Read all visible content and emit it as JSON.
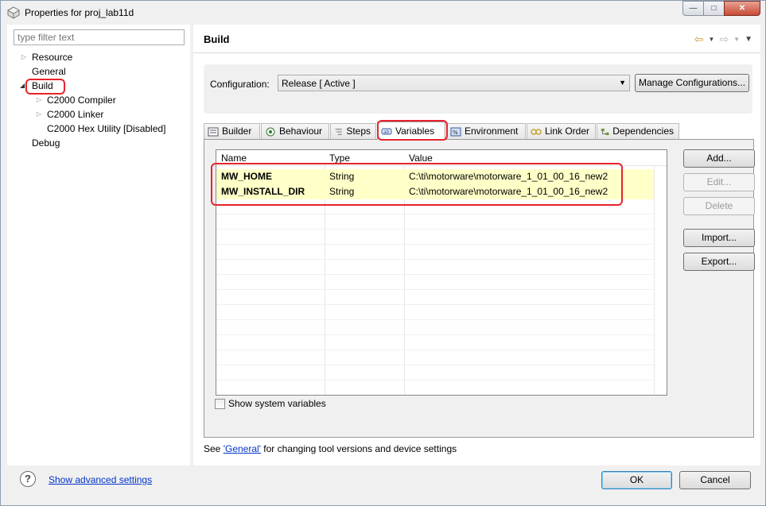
{
  "window": {
    "title": "Properties for proj_lab11d"
  },
  "filter": {
    "placeholder": "type filter text"
  },
  "tree": {
    "resource": "Resource",
    "general": "General",
    "build": "Build",
    "compiler": "C2000 Compiler",
    "linker": "C2000 Linker",
    "hex": "C2000 Hex Utility  [Disabled]",
    "debug": "Debug"
  },
  "page": {
    "title": "Build"
  },
  "config": {
    "label": "Configuration:",
    "value": "Release  [ Active ]",
    "manage_button": "Manage Configurations..."
  },
  "tabs": [
    "Builder",
    "Behaviour",
    "Steps",
    "Variables",
    "Environment",
    "Link Order",
    "Dependencies"
  ],
  "active_tab": "Variables",
  "table": {
    "headers": {
      "name": "Name",
      "type": "Type",
      "value": "Value"
    },
    "rows": [
      {
        "name": "MW_HOME",
        "type": "String",
        "value": "C:\\ti\\motorware\\motorware_1_01_00_16_new2"
      },
      {
        "name": "MW_INSTALL_DIR",
        "type": "String",
        "value": "C:\\ti\\motorware\\motorware_1_01_00_16_new2"
      }
    ]
  },
  "side_buttons": {
    "add": "Add...",
    "edit": "Edit...",
    "delete": "Delete",
    "import": "Import...",
    "export": "Export..."
  },
  "show_system": "Show system variables",
  "footnote": {
    "prefix": "See ",
    "link": "'General'",
    "suffix": " for changing tool versions and device settings"
  },
  "bottom": {
    "advanced": "Show advanced settings",
    "ok": "OK",
    "cancel": "Cancel"
  },
  "colors": {
    "highlight": "#e8232b",
    "row_bg": "#ffffc8",
    "link": "#0033cc"
  }
}
